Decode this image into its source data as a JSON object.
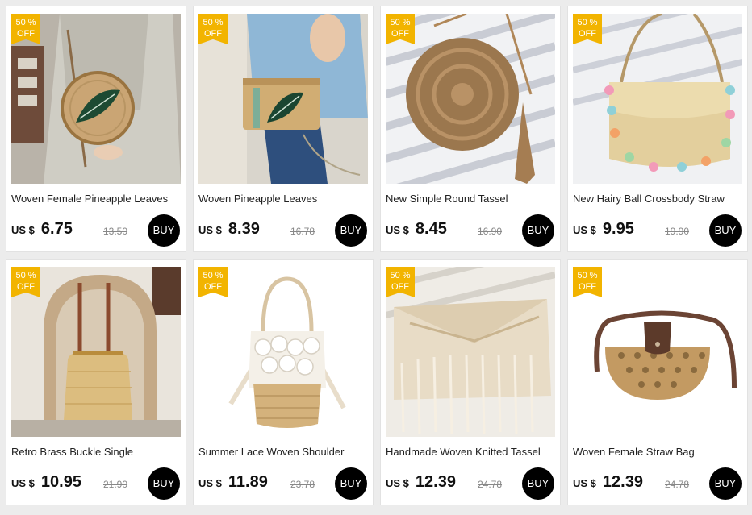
{
  "badge": {
    "line1": "50 %",
    "line2": "OFF"
  },
  "buy_label": "BUY",
  "colors": {
    "badge": "#f2b400",
    "buy_button": "#000000",
    "background": "#ececec"
  },
  "products": [
    {
      "title": "Woven Female Pineapple Leaves",
      "currency": "US $",
      "price": "6.75",
      "old_price": "13.50",
      "has_badge": true
    },
    {
      "title": "Woven Pineapple Leaves",
      "currency": "US $",
      "price": "8.39",
      "old_price": "16.78",
      "has_badge": true
    },
    {
      "title": "New Simple Round Tassel",
      "currency": "US $",
      "price": "8.45",
      "old_price": "16.90",
      "has_badge": true
    },
    {
      "title": "New Hairy Ball Crossbody Straw",
      "currency": "US $",
      "price": "9.95",
      "old_price": "19.90",
      "has_badge": true
    },
    {
      "title": "Retro Brass Buckle Single",
      "currency": "US $",
      "price": "10.95",
      "old_price": "21.90",
      "has_badge": true
    },
    {
      "title": "Summer Lace Woven Shoulder",
      "currency": "US $",
      "price": "11.89",
      "old_price": "23.78",
      "has_badge": true
    },
    {
      "title": "Handmade Woven Knitted Tassel",
      "currency": "US $",
      "price": "12.39",
      "old_price": "24.78",
      "has_badge": true
    },
    {
      "title": "Woven Female Straw Bag",
      "currency": "US $",
      "price": "12.39",
      "old_price": "24.78",
      "has_badge": true
    }
  ]
}
